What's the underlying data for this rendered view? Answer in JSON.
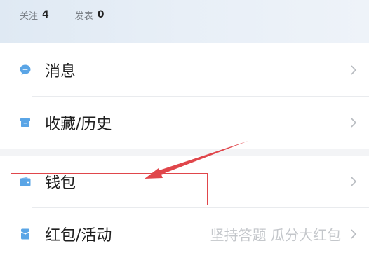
{
  "header": {
    "follow_label": "关注",
    "follow_count": "4",
    "posts_label": "发表",
    "posts_count": "0"
  },
  "menu": {
    "items": [
      {
        "label": "消息",
        "icon": "message-icon"
      },
      {
        "label": "收藏/历史",
        "icon": "archive-icon"
      },
      {
        "label": "钱包",
        "icon": "wallet-icon"
      },
      {
        "label": "红包/活动",
        "icon": "red-packet-icon",
        "extra": "坚持答题 瓜分大红包"
      }
    ]
  },
  "colors": {
    "accent_blue": "#5aa5e6",
    "annotation_red": "#e0464b"
  }
}
